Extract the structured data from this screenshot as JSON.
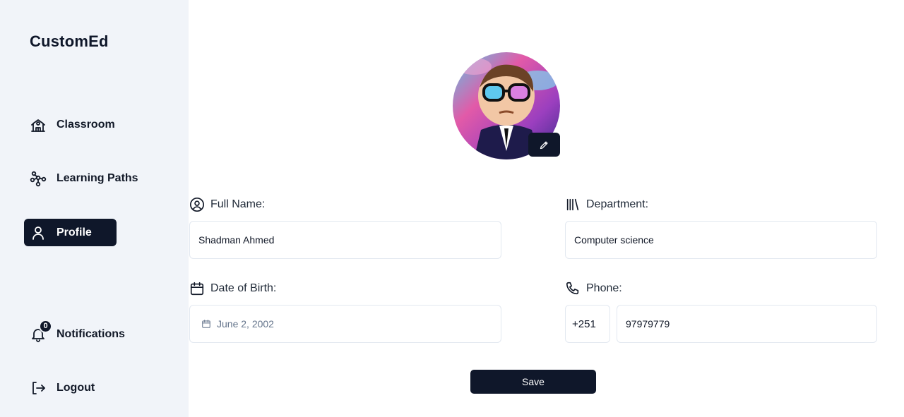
{
  "brand": "CustomEd",
  "sidebar": {
    "items": [
      {
        "label": "Classroom",
        "icon": "school-icon"
      },
      {
        "label": "Learning Paths",
        "icon": "path-icon"
      },
      {
        "label": "Profile",
        "icon": "user-icon",
        "active": true
      }
    ],
    "notifications": {
      "label": "Notifications",
      "count": "0",
      "icon": "bell-icon"
    },
    "logout": {
      "label": "Logout",
      "icon": "logout-icon"
    }
  },
  "profile": {
    "avatar_icon": "avatar-image",
    "edit_icon": "pencil-icon",
    "full_name": {
      "label": "Full Name:",
      "value": "Shadman Ahmed",
      "icon": "user-circle-icon"
    },
    "department": {
      "label": "Department:",
      "value": "Computer science",
      "icon": "library-icon"
    },
    "dob": {
      "label": "Date of Birth:",
      "value": "June 2, 2002",
      "icon": "calendar-icon"
    },
    "phone": {
      "label": "Phone:",
      "code": "+251",
      "value": "97979779",
      "icon": "phone-icon"
    },
    "save_label": "Save"
  },
  "colors": {
    "accent": "#0f172a",
    "sidebar_bg": "#f1f4f9",
    "border": "#e2e8f0"
  }
}
